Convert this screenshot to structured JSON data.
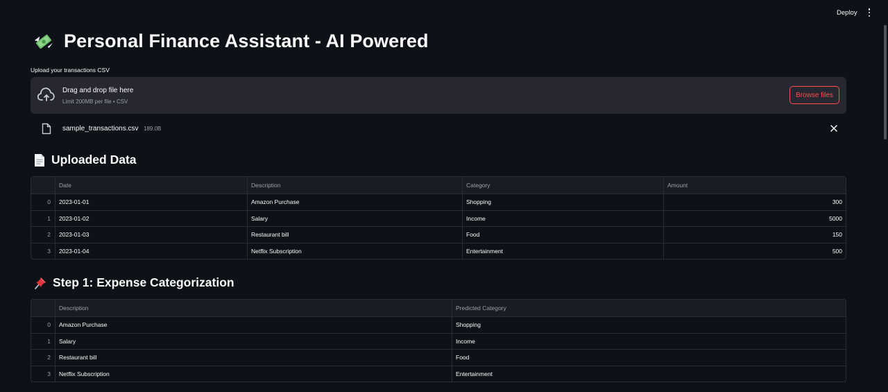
{
  "toolbar": {
    "deploy_label": "Deploy"
  },
  "app": {
    "title": "Personal Finance Assistant - AI Powered"
  },
  "uploader": {
    "label": "Upload your transactions CSV",
    "drop_text": "Drag and drop file here",
    "limit_text": "Limit 200MB per file • CSV",
    "browse_label": "Browse files",
    "file": {
      "name": "sample_transactions.csv",
      "size": "189.0B"
    }
  },
  "uploaded": {
    "heading": "Uploaded Data",
    "columns": [
      "Date",
      "Description",
      "Category",
      "Amount"
    ],
    "rows": [
      {
        "idx": "0",
        "date": "2023-01-01",
        "description": "Amazon Purchase",
        "category": "Shopping",
        "amount": "300"
      },
      {
        "idx": "1",
        "date": "2023-01-02",
        "description": "Salary",
        "category": "Income",
        "amount": "5000"
      },
      {
        "idx": "2",
        "date": "2023-01-03",
        "description": "Restaurant bill",
        "category": "Food",
        "amount": "150"
      },
      {
        "idx": "3",
        "date": "2023-01-04",
        "description": "Netflix Subscription",
        "category": "Entertainment",
        "amount": "500"
      }
    ]
  },
  "step1": {
    "heading": "Step 1: Expense Categorization",
    "columns": [
      "Description",
      "Predicted Category"
    ],
    "rows": [
      {
        "idx": "0",
        "description": "Amazon Purchase",
        "predicted": "Shopping"
      },
      {
        "idx": "1",
        "description": "Salary",
        "predicted": "Income"
      },
      {
        "idx": "2",
        "description": "Restaurant bill",
        "predicted": "Food"
      },
      {
        "idx": "3",
        "description": "Netflix Subscription",
        "predicted": "Entertainment"
      }
    ]
  },
  "colors": {
    "background": "#0e1117",
    "accent": "#ff4b4b",
    "surface": "#262730"
  }
}
